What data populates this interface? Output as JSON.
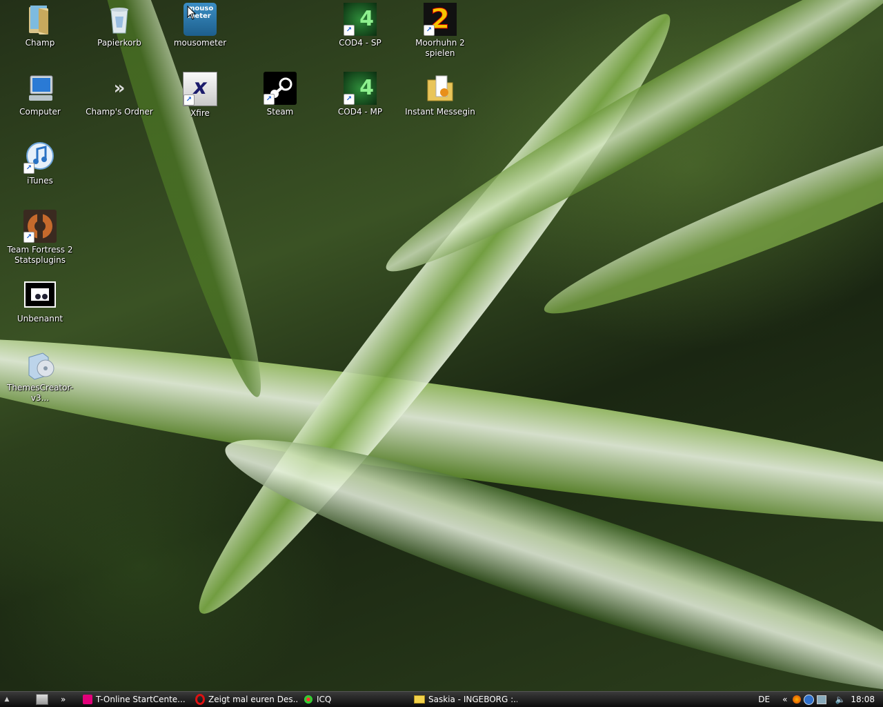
{
  "desktop": {
    "icons": [
      {
        "label": "Champ",
        "icon": "user-folder-icon"
      },
      {
        "label": "Papierkorb",
        "icon": "recycle-bin-icon"
      },
      {
        "label": "mousometer",
        "icon": "mousometer-icon",
        "badge": "mouso\nmeter"
      },
      {
        "label": "COD4 - SP",
        "icon": "cod4-icon",
        "badge": "4"
      },
      {
        "label": "Moorhuhn 2 spielen",
        "icon": "moorhuhn-icon",
        "badge": "2"
      },
      {
        "label": "Computer",
        "icon": "computer-icon"
      },
      {
        "label": "Champ's Ordner",
        "icon": "folder-shortcut-icon",
        "badge": "»"
      },
      {
        "label": "Xfire",
        "icon": "xfire-icon",
        "badge": "x"
      },
      {
        "label": "Steam",
        "icon": "steam-icon"
      },
      {
        "label": "COD4 - MP",
        "icon": "cod4-icon",
        "badge": "4"
      },
      {
        "label": "Instant Messegin",
        "icon": "folder-icon"
      },
      {
        "label": "iTunes",
        "icon": "itunes-icon"
      },
      {
        "label": "Team Fortress 2 Statsplugins",
        "icon": "tf2-icon"
      },
      {
        "label": "Unbenannt",
        "icon": "image-file-icon"
      },
      {
        "label": "ThemesCreator-v3...",
        "icon": "installer-icon"
      }
    ]
  },
  "taskbar": {
    "items": [
      {
        "label": "T-Online StartCente...",
        "icon": "tonline-icon"
      },
      {
        "label": "Zeigt mal euren Des...",
        "icon": "opera-icon"
      },
      {
        "label": "ICQ",
        "icon": "icq-flower-icon"
      },
      {
        "label": "Saskia - INGEBORG :...",
        "icon": "chat-window-icon"
      }
    ],
    "overflow_chevron": "»",
    "tray_expand": "«",
    "language": "DE",
    "clock": "18:08"
  },
  "colors": {
    "taskbar_bg": "#0c0c0c",
    "wallpaper_green": "#3a5224",
    "label_text": "#ffffff"
  }
}
